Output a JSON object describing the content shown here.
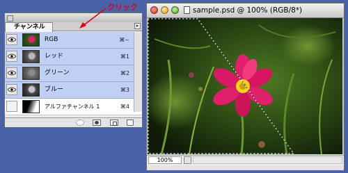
{
  "palette": {
    "tab_label": "チャンネル",
    "channels": [
      {
        "name": "RGB",
        "shortcut": "⌘~",
        "selected": true,
        "visible": true
      },
      {
        "name": "レッド",
        "shortcut": "⌘1",
        "selected": true,
        "visible": true
      },
      {
        "name": "グリーン",
        "shortcut": "⌘2",
        "selected": true,
        "visible": true
      },
      {
        "name": "ブルー",
        "shortcut": "⌘3",
        "selected": true,
        "visible": true
      },
      {
        "name": "アルファチャンネル 1",
        "shortcut": "⌘4",
        "selected": false,
        "visible": false
      }
    ],
    "bottom_icons": [
      "load-selection-icon",
      "save-selection-icon",
      "new-channel-icon",
      "trash-icon"
    ]
  },
  "document": {
    "title": "sample.psd @ 100% (RGB/8*)",
    "zoom": "100%"
  },
  "annotation": {
    "label": "クリック",
    "color": "#e0001a"
  },
  "colors": {
    "desktop": "#4a63a8",
    "selected_row": "#bfd0f4",
    "flower": "#e0206a"
  }
}
